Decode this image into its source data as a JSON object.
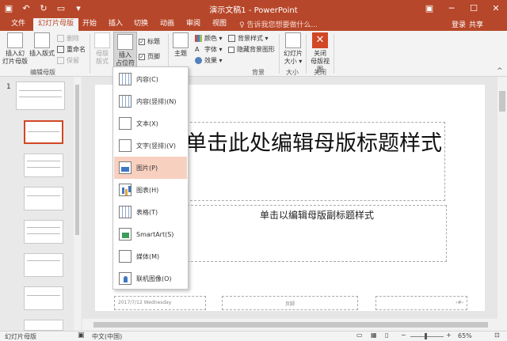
{
  "title_bar": {
    "title": "演示文稿1 - PowerPoint",
    "qat_icons": [
      "save-icon",
      "undo-icon",
      "redo-icon",
      "start-presentation-icon",
      "customize-icon"
    ]
  },
  "tabs": {
    "file": "文件",
    "slide_master": "幻灯片母版",
    "home": "开始",
    "insert": "插入",
    "transitions": "切换",
    "animations": "动画",
    "review": "审阅",
    "view": "视图",
    "tell_me": "♀ 告诉我您想要做什么...",
    "login": "登录",
    "share": "共享"
  },
  "ribbon": {
    "insert_slide_master": "插入幻\n灯片母版",
    "insert_layout": "插入版式",
    "delete": "删除",
    "rename": "重命名",
    "preserve": "保留",
    "group_edit_master": "编辑母版",
    "master_layout": "母版\n版式",
    "insert_placeholder": "插入\n占位符 ▾",
    "title_checkbox": "标题",
    "footer_checkbox": "页脚",
    "themes": "主题",
    "colors": "颜色 ▾",
    "fonts": "字体 ▾",
    "effects": "效果 ▾",
    "background_styles": "背景样式 ▾",
    "hide_background": "隐藏背景图形",
    "group_background": "背景",
    "slide_size": "幻灯片\n大小 ▾",
    "group_size": "大小",
    "close_master_view": "关闭\n母版视图",
    "group_close": "关闭"
  },
  "placeholder_menu": [
    {
      "label": "内容(C)",
      "icon": "content-placeholder-icon"
    },
    {
      "label": "内容(竖排)(N)",
      "icon": "content-vertical-placeholder-icon"
    },
    {
      "label": "文本(X)",
      "icon": "text-placeholder-icon"
    },
    {
      "label": "文字(竖排)(V)",
      "icon": "text-vertical-placeholder-icon"
    },
    {
      "label": "图片(P)",
      "icon": "picture-placeholder-icon"
    },
    {
      "label": "图表(H)",
      "icon": "chart-placeholder-icon"
    },
    {
      "label": "表格(T)",
      "icon": "table-placeholder-icon"
    },
    {
      "label": "SmartArt(S)",
      "icon": "smartart-placeholder-icon"
    },
    {
      "label": "媒体(M)",
      "icon": "media-placeholder-icon"
    },
    {
      "label": "联机图像(O)",
      "icon": "online-image-placeholder-icon"
    }
  ],
  "slide": {
    "title": "单击此处编辑母版标题样式",
    "subtitle": "单击以编辑母版副标题样式",
    "date": "2017/7/12 Wednesday",
    "footer": "页脚",
    "slide_number": "‹#›"
  },
  "thumbnails": {
    "number": "1"
  },
  "status_bar": {
    "view_name": "幻灯片母版",
    "language": "中文(中国)",
    "zoom": "65%"
  }
}
